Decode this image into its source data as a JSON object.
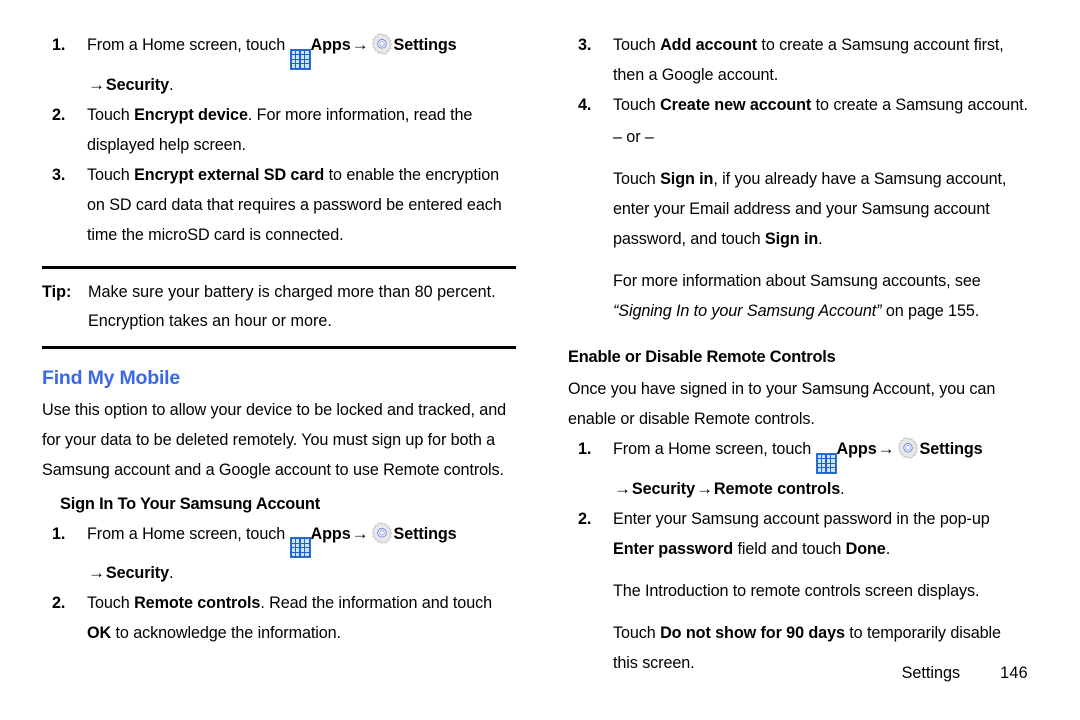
{
  "document": {
    "type": "user-manual-page",
    "footer": {
      "section": "Settings",
      "page_number": "146"
    },
    "accent_color": "#3a68e8",
    "icons": {
      "apps": "apps-grid-icon",
      "settings": "gear-icon",
      "arrow": "→"
    }
  },
  "left_column": {
    "steps_encrypt": [
      {
        "num": "1.",
        "line1_pre": "From a Home screen, touch ",
        "apps_label": "Apps",
        "settings_label": "Settings",
        "line2_target": "Security",
        "line2_period": "."
      },
      {
        "num": "2.",
        "text_pre": "Touch ",
        "bold": "Encrypt device",
        "text_post": ". For more information, read the displayed help screen."
      },
      {
        "num": "3.",
        "text_pre": "Touch ",
        "bold": "Encrypt external SD card",
        "text_post": " to enable the encryption on SD card data that requires a password be entered each time the microSD card is connected."
      }
    ],
    "tip": {
      "label": "Tip:",
      "text": "Make sure your battery is charged more than 80 percent. Encryption takes an hour or more."
    },
    "heading": "Find My Mobile",
    "intro": "Use this option to allow your device to be locked and tracked, and for your data to be deleted remotely. You must sign up for both a Samsung account and a Google account to use Remote controls.",
    "subheading": "Sign In To Your Samsung Account",
    "steps_signin": [
      {
        "num": "1.",
        "line1_pre": "From a Home screen, touch ",
        "apps_label": "Apps",
        "settings_label": "Settings",
        "line2_target": "Security",
        "line2_period": "."
      },
      {
        "num": "2.",
        "text_pre": "Touch ",
        "bold": "Remote controls",
        "text_mid": ". Read the information and touch ",
        "bold2": "OK",
        "text_post": " to acknowledge the information."
      }
    ]
  },
  "right_column": {
    "steps_account": [
      {
        "num": "3.",
        "text_pre": "Touch ",
        "bold": "Add account",
        "text_post": " to create a Samsung account first, then a Google account."
      },
      {
        "num": "4.",
        "text_pre": "Touch ",
        "bold": "Create new account",
        "text_post": " to create a Samsung account."
      }
    ],
    "or_divider": "– or –",
    "signin_para": {
      "pre": "Touch ",
      "bold1": "Sign in",
      "mid": ", if you already have a Samsung account, enter your Email address and your Samsung account password, and touch ",
      "bold2": "Sign in",
      "post": "."
    },
    "crossref": {
      "pre": "For more information about Samsung accounts, see ",
      "italic": "“Signing In to your Samsung Account”",
      "post": " on page 155."
    },
    "subheading": "Enable or Disable Remote Controls",
    "intro": "Once you have signed in to your Samsung Account, you can enable or disable Remote controls.",
    "steps_remote": [
      {
        "num": "1.",
        "line1_pre": "From a Home screen, touch ",
        "apps_label": "Apps",
        "settings_label": "Settings",
        "line2_target1": "Security",
        "line2_target2": "Remote controls",
        "line2_period": "."
      },
      {
        "num": "2.",
        "text_pre": "Enter your Samsung account password in the pop-up ",
        "bold": "Enter password",
        "text_mid": " field and touch ",
        "bold2": "Done",
        "text_post": "."
      }
    ],
    "result_para": "The Introduction to remote controls screen displays.",
    "disable_para": {
      "pre": "Touch ",
      "bold": "Do not show for 90 days",
      "post": " to temporarily disable this screen."
    }
  }
}
